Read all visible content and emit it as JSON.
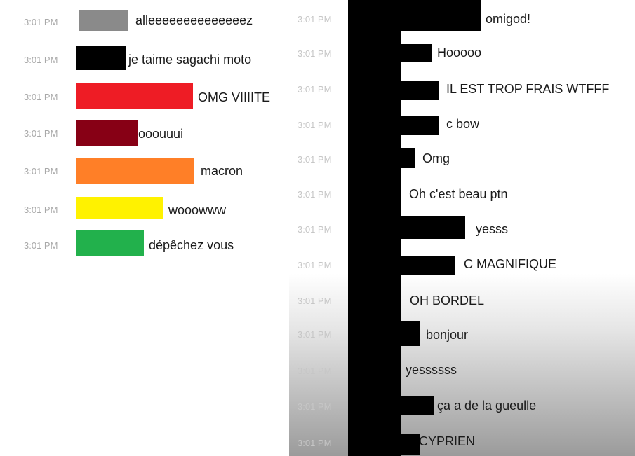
{
  "left_chat": {
    "messages": [
      {
        "time": "3:01 PM",
        "text": "alleeeeeeeeeeeeeez",
        "color": "#8a8a8a"
      },
      {
        "time": "3:01 PM",
        "text": "je taime sagachi moto",
        "color": "#000000"
      },
      {
        "time": "3:01 PM",
        "text": "OMG VIIIITE",
        "color": "#ee1c25"
      },
      {
        "time": "3:01 PM",
        "text": "ooouuui",
        "color": "#870015"
      },
      {
        "time": "3:01 PM",
        "text": "macron",
        "color": "#ff7f27"
      },
      {
        "time": "3:01 PM",
        "text": "wooowww",
        "color": "#fff200"
      },
      {
        "time": "3:01 PM",
        "text": "dépêchez vous",
        "color": "#22b14c"
      }
    ]
  },
  "right_chat": {
    "redaction_color": "#000000",
    "messages": [
      {
        "time": "3:01 PM",
        "text": "omigod!"
      },
      {
        "time": "3:01 PM",
        "text": "Hooooo"
      },
      {
        "time": "3:01 PM",
        "text": "IL EST TROP FRAIS WTFFF"
      },
      {
        "time": "3:01 PM",
        "text": "c bow"
      },
      {
        "time": "3:01 PM",
        "text": "Omg"
      },
      {
        "time": "3:01 PM",
        "text": "Oh c'est beau ptn"
      },
      {
        "time": "3:01 PM",
        "text": "yesss"
      },
      {
        "time": "3:01 PM",
        "text": "C MAGNIFIQUE"
      },
      {
        "time": "3:01 PM",
        "text": "OH BORDEL"
      },
      {
        "time": "3:01 PM",
        "text": "bonjour"
      },
      {
        "time": "3:01 PM",
        "text": "yessssss"
      },
      {
        "time": "3:01 PM",
        "text": "ça a de la gueulle"
      },
      {
        "time": "3:01 PM",
        "text": "CYPRIEN"
      }
    ]
  }
}
